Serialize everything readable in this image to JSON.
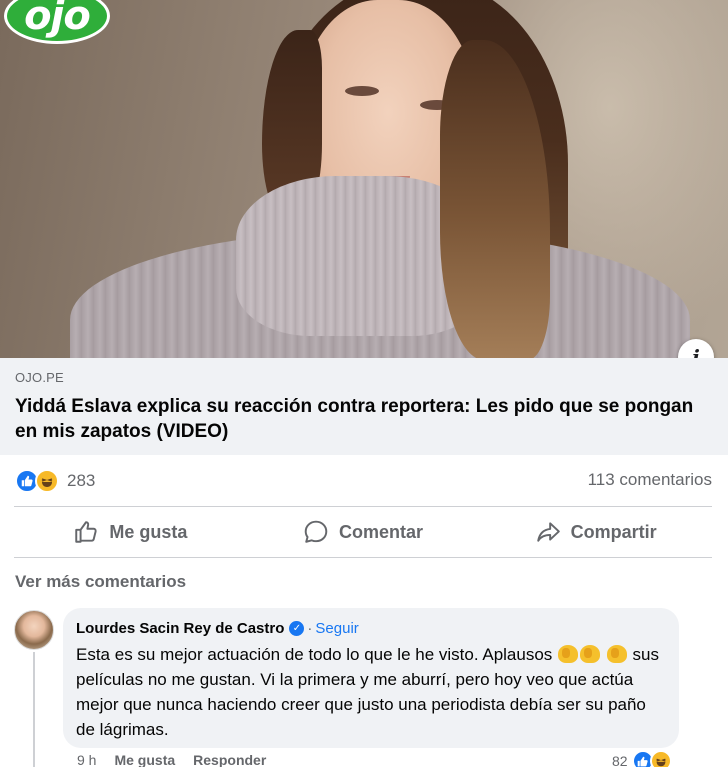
{
  "post": {
    "logo_text": "ojo",
    "link": {
      "domain": "OJO.PE",
      "title": "Yiddá Eslava explica su reacción contra reportera: Les pido que se pongan en mis zapatos (VIDEO)"
    },
    "reactions": {
      "count": "283",
      "icons": [
        "like-icon",
        "haha-icon"
      ]
    },
    "comments_count": "113 comentarios",
    "actions": {
      "like": "Me gusta",
      "comment": "Comentar",
      "share": "Compartir"
    },
    "more_comments": "Ver más comentarios"
  },
  "comment": {
    "author": "Lourdes Sacin Rey de Castro",
    "separator": "·",
    "follow": "Seguir",
    "text_1": "Esta es su mejor actuación de todo lo que le he visto. Aplausos",
    "text_2": "sus películas no me gustan. Vi la primera y me aburrí, pero hoy veo que actúa mejor que nunca haciendo creer que justo una periodista debía ser su paño de lágrimas.",
    "time": "9 h",
    "like": "Me gusta",
    "reply": "Responder",
    "reaction_count": "82"
  },
  "colors": {
    "accent": "#1877f2",
    "secondary_text": "#65676b",
    "link_box_bg": "#f0f2f5",
    "logo_green": "#2fae3a"
  }
}
